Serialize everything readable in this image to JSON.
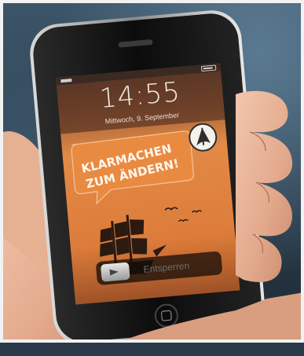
{
  "lockscreen": {
    "time": "14:55",
    "date": "Mittwoch, 9. September",
    "banner_line1": "KLARMACHEN",
    "banner_line2": "ZUM ÄNDERN!",
    "slider_text": "Entsperren"
  },
  "colors": {
    "screen_orange": "#e2813a",
    "status_bar": "#6b4a38",
    "phone_body": "#121212",
    "skin": "#e8b69a"
  },
  "icons": [
    "pirate-party-logo-icon",
    "pirate-ship-icon",
    "slider-arrow-icon",
    "home-button-icon"
  ]
}
